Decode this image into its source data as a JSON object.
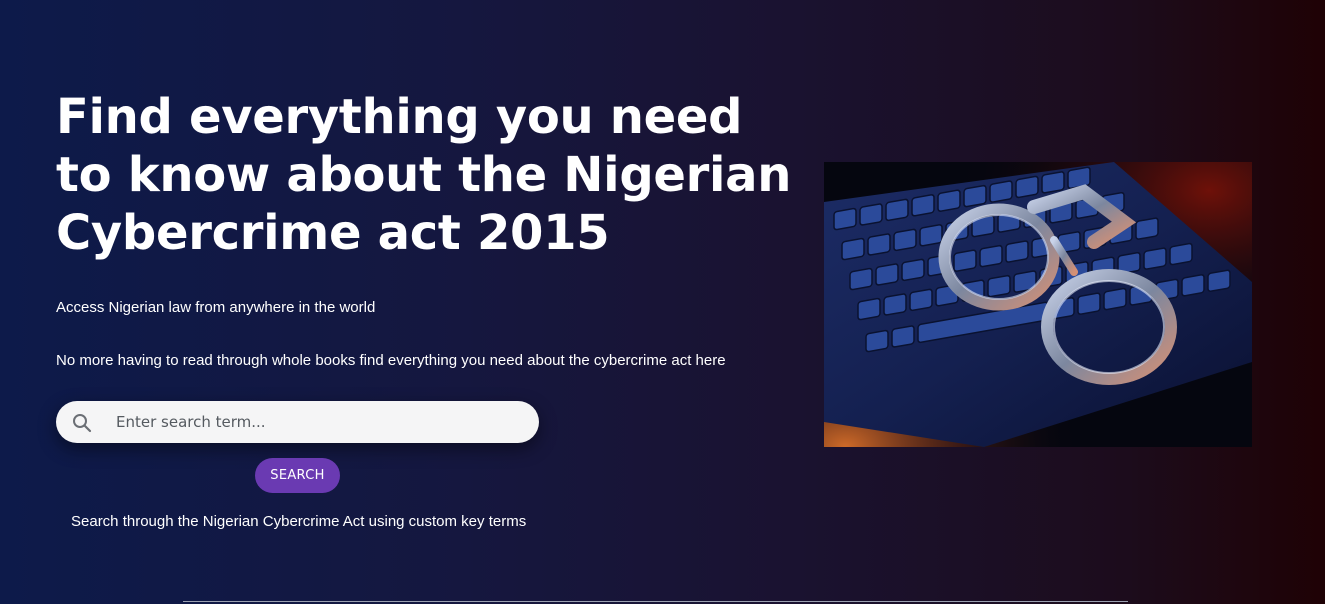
{
  "hero": {
    "headline": "Find everything you need to know about the Nigerian Cybercrime act 2015",
    "subtitle_1": "Access Nigerian law from anywhere in the world",
    "subtitle_2": "No more having to read through whole books find everything you need about the cybercrime act here",
    "image_icon": "keyboard-handcuffs-image"
  },
  "search": {
    "placeholder": "Enter search term...",
    "value": "",
    "icon": "search-icon",
    "button_label": "SEARCH",
    "helper_text": "Search through the Nigerian Cybercrime Act using custom key terms"
  },
  "colors": {
    "background_left": "#0d1a4a",
    "background_right": "#1f0205",
    "button": "#6a3ab2",
    "search_field": "#f5f5f6",
    "text": "#ffffff"
  }
}
